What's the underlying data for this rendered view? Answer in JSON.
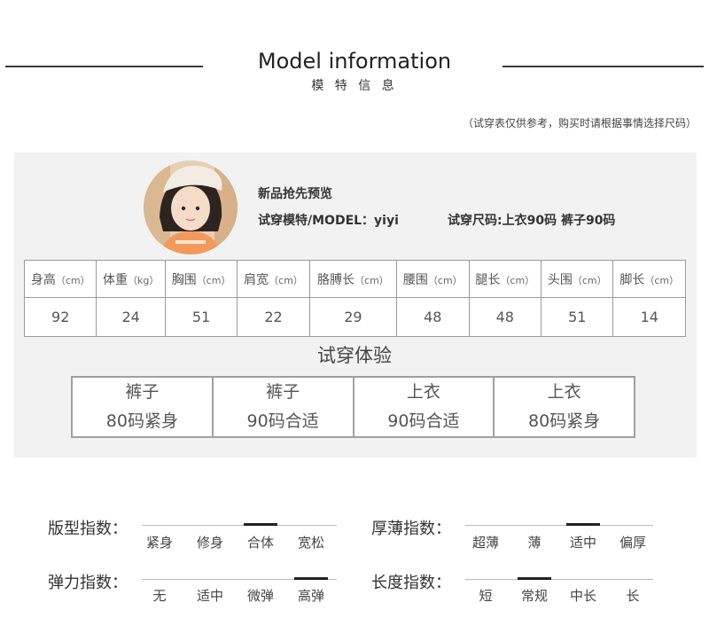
{
  "header": {
    "title_en": "Model information",
    "title_cn": "模 特 信 息",
    "note": "（试穿表仅供参考，购买时请根据事情选择尺码）"
  },
  "model": {
    "line1": "新品抢先预览",
    "line2_model": "试穿模特/MODEL：yiyi",
    "line2_size": "试穿尺码:上衣90码 裤子90码"
  },
  "measurements": {
    "headers": [
      {
        "label": "身高",
        "unit": "（cm）"
      },
      {
        "label": "体重",
        "unit": "（kg）"
      },
      {
        "label": "胸围",
        "unit": "（cm）"
      },
      {
        "label": "肩宽",
        "unit": "（cm）"
      },
      {
        "label": "胳膊长",
        "unit": "（cm）"
      },
      {
        "label": "腰围",
        "unit": "（cm）"
      },
      {
        "label": "腿长",
        "unit": "（cm）"
      },
      {
        "label": "头围",
        "unit": "（cm）"
      },
      {
        "label": "脚长",
        "unit": "（cm）"
      }
    ],
    "values": [
      "92",
      "24",
      "51",
      "22",
      "29",
      "48",
      "48",
      "51",
      "14"
    ]
  },
  "try_on": {
    "title": "试穿体验",
    "items": [
      {
        "name": "裤子",
        "result": "80码紧身"
      },
      {
        "name": "裤子",
        "result": "90码合适"
      },
      {
        "name": "上衣",
        "result": "90码合适"
      },
      {
        "name": "上衣",
        "result": "80码紧身"
      }
    ]
  },
  "scales": {
    "fit": {
      "label": "版型指数：",
      "options": [
        "紧身",
        "修身",
        "合体",
        "宽松"
      ],
      "selected": 2
    },
    "thickness": {
      "label": "厚薄指数：",
      "options": [
        "超薄",
        "薄",
        "适中",
        "偏厚"
      ],
      "selected": 2
    },
    "elasticity": {
      "label": "弹力指数：",
      "options": [
        "无",
        "适中",
        "微弹",
        "高弹"
      ],
      "selected": 3
    },
    "length": {
      "label": "长度指数：",
      "options": [
        "短",
        "常规",
        "中长",
        "长"
      ],
      "selected": 1
    }
  },
  "colors": {
    "rule": "#3a3a3a",
    "panel": "#f2f2f2",
    "marker": "#222222"
  }
}
